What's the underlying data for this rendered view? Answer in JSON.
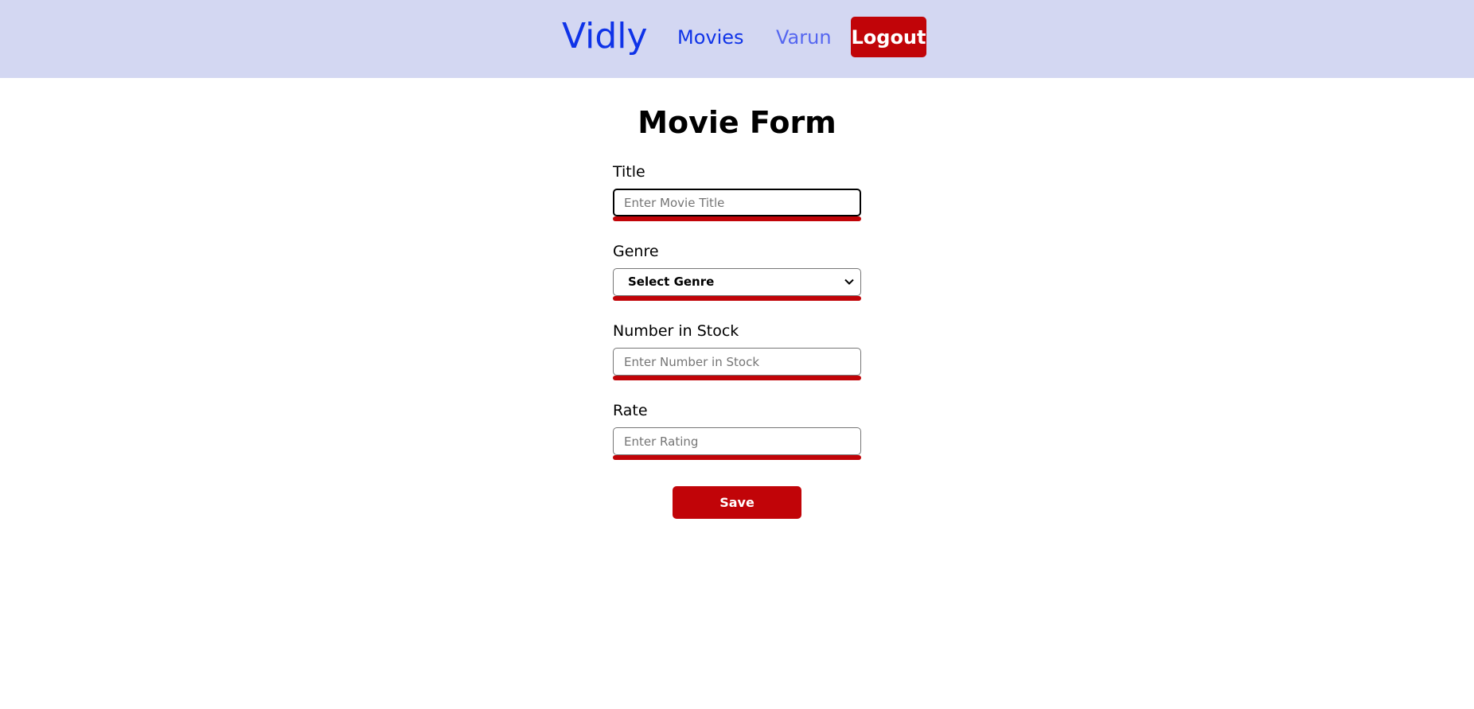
{
  "navbar": {
    "brand": "Vidly",
    "movies_link": "Movies",
    "user_link": "Varun",
    "logout_label": "Logout",
    "background_color": "#d3d7f2",
    "link_color": "#0f33e8"
  },
  "form": {
    "title": "Movie Form",
    "fields": {
      "title": {
        "label": "Title",
        "placeholder": "Enter Movie Title",
        "value": ""
      },
      "genre": {
        "label": "Genre",
        "selected": "Select Genre"
      },
      "stock": {
        "label": "Number in Stock",
        "placeholder": "Enter Number in Stock",
        "value": ""
      },
      "rate": {
        "label": "Rate",
        "placeholder": "Enter Rating",
        "value": ""
      }
    },
    "save_label": "Save",
    "accent_color": "#c10408"
  }
}
